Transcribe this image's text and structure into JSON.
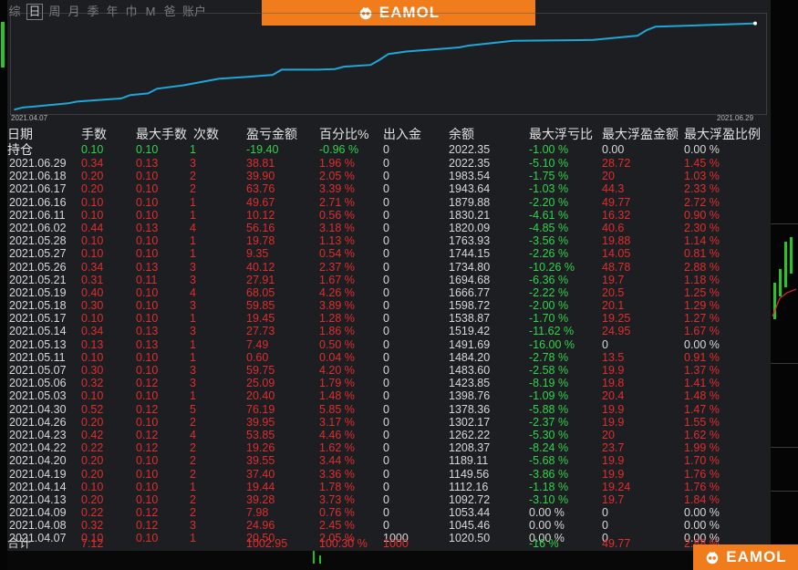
{
  "toolbar": {
    "timeframes": [
      "综",
      "日",
      "周",
      "月",
      "季",
      "年",
      "巾",
      "M",
      "爸",
      "账户"
    ],
    "active_index": 1
  },
  "brand": {
    "logo_text": "EAMOL",
    "accent": "#f07c1c"
  },
  "colors": {
    "equity_line": "#1ea7d8",
    "profit": "#e02d2d",
    "loss": "#2fd44a",
    "bg": "#1d1e21"
  },
  "chart": {
    "date_start": "2021.04.07",
    "date_end": "2021.06.29"
  },
  "chart_data": {
    "type": "line",
    "x": [
      "2021.04.07",
      "2021.04.08",
      "2021.04.09",
      "2021.04.13",
      "2021.04.14",
      "2021.04.19",
      "2021.04.20",
      "2021.04.22",
      "2021.04.23",
      "2021.04.26",
      "2021.04.30",
      "2021.05.03",
      "2021.05.06",
      "2021.05.07",
      "2021.05.11",
      "2021.05.13",
      "2021.05.14",
      "2021.05.17",
      "2021.05.18",
      "2021.05.19",
      "2021.05.21",
      "2021.05.26",
      "2021.05.27",
      "2021.05.28",
      "2021.06.02",
      "2021.06.11",
      "2021.06.16",
      "2021.06.17",
      "2021.06.18",
      "2021.06.29"
    ],
    "values": [
      1020.5,
      1045.46,
      1053.44,
      1092.72,
      1112.16,
      1149.56,
      1189.11,
      1208.37,
      1262.22,
      1302.17,
      1378.36,
      1398.76,
      1423.85,
      1483.6,
      1484.2,
      1491.69,
      1519.42,
      1538.87,
      1598.72,
      1666.77,
      1694.68,
      1734.8,
      1744.15,
      1763.93,
      1820.09,
      1830.21,
      1879.88,
      1943.64,
      1983.54,
      2022.35
    ]
  },
  "table": {
    "headers": [
      "日期",
      "手数",
      "最大手数",
      "次数",
      "盈亏金额",
      "百分比%",
      "出入金",
      "余额",
      "最大浮亏比",
      "最大浮盈金额",
      "最大浮盈比例"
    ],
    "hold_row": [
      "持仓",
      "0.10",
      "0.10",
      "1",
      "-19.40",
      "-0.96 %",
      "0",
      "2022.35",
      "-1.00 %",
      "0.00",
      "0.00 %"
    ],
    "rows": [
      [
        "2021.06.29",
        "0.34",
        "0.13",
        "3",
        "38.81",
        "1.96 %",
        "0",
        "2022.35",
        "-5.10 %",
        "28.72",
        "1.45 %"
      ],
      [
        "2021.06.18",
        "0.20",
        "0.10",
        "2",
        "39.90",
        "2.05 %",
        "0",
        "1983.54",
        "-1.75 %",
        "20",
        "1.03 %"
      ],
      [
        "2021.06.17",
        "0.20",
        "0.10",
        "2",
        "63.76",
        "3.39 %",
        "0",
        "1943.64",
        "-1.03 %",
        "44.3",
        "2.33 %"
      ],
      [
        "2021.06.16",
        "0.10",
        "0.10",
        "1",
        "49.67",
        "2.71 %",
        "0",
        "1879.88",
        "-2.20 %",
        "49.77",
        "2.72 %"
      ],
      [
        "2021.06.11",
        "0.10",
        "0.10",
        "1",
        "10.12",
        "0.56 %",
        "0",
        "1830.21",
        "-4.61 %",
        "16.32",
        "0.90 %"
      ],
      [
        "2021.06.02",
        "0.44",
        "0.13",
        "4",
        "56.16",
        "3.18 %",
        "0",
        "1820.09",
        "-4.85 %",
        "40.6",
        "2.30 %"
      ],
      [
        "2021.05.28",
        "0.10",
        "0.10",
        "1",
        "19.78",
        "1.13 %",
        "0",
        "1763.93",
        "-3.56 %",
        "19.88",
        "1.14 %"
      ],
      [
        "2021.05.27",
        "0.10",
        "0.10",
        "1",
        "9.35",
        "0.54 %",
        "0",
        "1744.15",
        "-2.26 %",
        "14.05",
        "0.81 %"
      ],
      [
        "2021.05.26",
        "0.34",
        "0.13",
        "3",
        "40.12",
        "2.37 %",
        "0",
        "1734.80",
        "-10.26 %",
        "48.78",
        "2.88 %"
      ],
      [
        "2021.05.21",
        "0.31",
        "0.11",
        "3",
        "27.91",
        "1.67 %",
        "0",
        "1694.68",
        "-6.36 %",
        "19.7",
        "1.18 %"
      ],
      [
        "2021.05.19",
        "0.40",
        "0.10",
        "4",
        "68.05",
        "4.26 %",
        "0",
        "1666.77",
        "-2.22 %",
        "20.5",
        "1.25 %"
      ],
      [
        "2021.05.18",
        "0.30",
        "0.10",
        "3",
        "59.85",
        "3.89 %",
        "0",
        "1598.72",
        "-2.00 %",
        "20.1",
        "1.29 %"
      ],
      [
        "2021.05.17",
        "0.10",
        "0.10",
        "1",
        "19.45",
        "1.28 %",
        "0",
        "1538.87",
        "-1.70 %",
        "19.25",
        "1.27 %"
      ],
      [
        "2021.05.14",
        "0.34",
        "0.13",
        "3",
        "27.73",
        "1.86 %",
        "0",
        "1519.42",
        "-11.62 %",
        "24.95",
        "1.67 %"
      ],
      [
        "2021.05.13",
        "0.13",
        "0.13",
        "1",
        "7.49",
        "0.50 %",
        "0",
        "1491.69",
        "-16.00 %",
        "0",
        "0.00 %"
      ],
      [
        "2021.05.11",
        "0.10",
        "0.10",
        "1",
        "0.60",
        "0.04 %",
        "0",
        "1484.20",
        "-2.78 %",
        "13.5",
        "0.91 %"
      ],
      [
        "2021.05.07",
        "0.30",
        "0.10",
        "3",
        "59.75",
        "4.20 %",
        "0",
        "1483.60",
        "-2.58 %",
        "19.9",
        "1.37 %"
      ],
      [
        "2021.05.06",
        "0.32",
        "0.12",
        "3",
        "25.09",
        "1.79 %",
        "0",
        "1423.85",
        "-8.19 %",
        "19.8",
        "1.41 %"
      ],
      [
        "2021.05.03",
        "0.10",
        "0.10",
        "1",
        "20.40",
        "1.48 %",
        "0",
        "1398.76",
        "-1.09 %",
        "20.4",
        "1.48 %"
      ],
      [
        "2021.04.30",
        "0.52",
        "0.12",
        "5",
        "76.19",
        "5.85 %",
        "0",
        "1378.36",
        "-5.88 %",
        "19.9",
        "1.47 %"
      ],
      [
        "2021.04.26",
        "0.20",
        "0.10",
        "2",
        "39.95",
        "3.17 %",
        "0",
        "1302.17",
        "-2.37 %",
        "19.9",
        "1.55 %"
      ],
      [
        "2021.04.23",
        "0.42",
        "0.12",
        "4",
        "53.85",
        "4.46 %",
        "0",
        "1262.22",
        "-5.30 %",
        "20",
        "1.62 %"
      ],
      [
        "2021.04.22",
        "0.22",
        "0.12",
        "2",
        "19.26",
        "1.62 %",
        "0",
        "1208.37",
        "-8.24 %",
        "23.7",
        "1.99 %"
      ],
      [
        "2021.04.20",
        "0.20",
        "0.10",
        "2",
        "39.55",
        "3.44 %",
        "0",
        "1189.11",
        "-5.68 %",
        "19.9",
        "1.70 %"
      ],
      [
        "2021.04.19",
        "0.20",
        "0.10",
        "2",
        "37.40",
        "3.36 %",
        "0",
        "1149.56",
        "-3.86 %",
        "19.9",
        "1.76 %"
      ],
      [
        "2021.04.14",
        "0.10",
        "0.10",
        "1",
        "19.44",
        "1.78 %",
        "0",
        "1112.16",
        "-1.18 %",
        "19.24",
        "1.76 %"
      ],
      [
        "2021.04.13",
        "0.20",
        "0.10",
        "2",
        "39.28",
        "3.73 %",
        "0",
        "1092.72",
        "-3.10 %",
        "19.7",
        "1.84 %"
      ],
      [
        "2021.04.09",
        "0.22",
        "0.12",
        "2",
        "7.98",
        "0.76 %",
        "0",
        "1053.44",
        "0.00 %",
        "0",
        "0.00 %"
      ],
      [
        "2021.04.08",
        "0.32",
        "0.12",
        "3",
        "24.96",
        "2.45 %",
        "0",
        "1045.46",
        "0.00 %",
        "0",
        "0.00 %"
      ],
      [
        "2021.04.07",
        "0.10",
        "0.10",
        "1",
        "20.50",
        "2.05 %",
        "1000",
        "1020.50",
        "0.00 %",
        "0",
        "0.00 %"
      ]
    ],
    "total_row": [
      "合计",
      "7.12",
      "",
      "",
      "1002.95",
      "100.30 %",
      "1000",
      "",
      "-16 %",
      "49.77",
      "2.88 %"
    ]
  }
}
